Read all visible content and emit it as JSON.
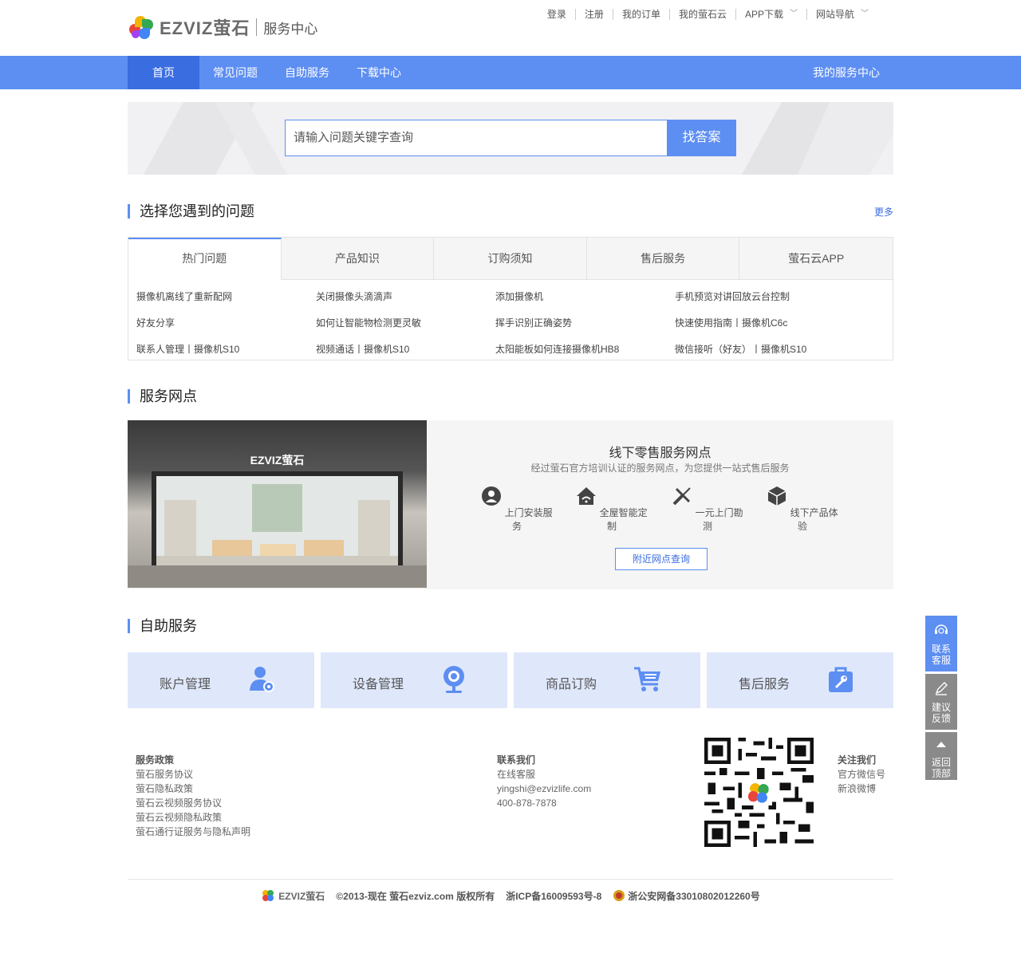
{
  "header": {
    "brand": "EZVIZ萤石",
    "service_center": "服务中心",
    "links": [
      "登录",
      "注册",
      "我的订单",
      "我的萤石云",
      "APP下载",
      "网站导航"
    ]
  },
  "nav": {
    "items": [
      "首页",
      "常见问题",
      "自助服务",
      "下载中心"
    ],
    "right": "我的服务中心"
  },
  "search": {
    "placeholder": "请输入问题关键字查询",
    "button": "找答案"
  },
  "problems": {
    "title": "选择您遇到的问题",
    "more": "更多",
    "tabs": [
      "热门问题",
      "产品知识",
      "订购须知",
      "售后服务",
      "萤石云APP"
    ],
    "links": [
      "摄像机离线了重新配网",
      "关闭摄像头滴滴声",
      "添加摄像机",
      "手机预览对讲回放云台控制",
      "好友分享",
      "如何让智能物检测更灵敏",
      "挥手识别正确姿势",
      "快速使用指南丨摄像机C6c",
      "联系人管理丨摄像机S10",
      "视频通话丨摄像机S10",
      "太阳能板如何连接摄像机HB8",
      "微信接听（好友）丨摄像机S10"
    ]
  },
  "outlets": {
    "title": "服务网点",
    "store_sign": "EZVIZ萤石",
    "heading": "线下零售服务网点",
    "subtitle": "经过萤石官方培训认证的服务网点，为您提供一站式售后服务",
    "features": [
      "上门安装服务",
      "全屋智能定制",
      "一元上门勘测",
      "线下产品体验"
    ],
    "button": "附近网点查询"
  },
  "self_service": {
    "title": "自助服务",
    "cards": [
      "账户管理",
      "设备管理",
      "商品订购",
      "售后服务"
    ]
  },
  "footer": {
    "policy": {
      "heading": "服务政策",
      "items": [
        "萤石服务协议",
        "萤石隐私政策",
        "萤石云视频服务协议",
        "萤石云视频隐私政策",
        "萤石通行证服务与隐私声明"
      ]
    },
    "contact": {
      "heading": "联系我们",
      "items": [
        "在线客服",
        "yingshi@ezvizlife.com",
        "400-878-7878"
      ]
    },
    "follow": {
      "heading": "关注我们",
      "items": [
        "官方微信号",
        "新浪微博"
      ]
    },
    "bottom": {
      "brand": "EZVIZ萤石",
      "copyright": "©2013-现在 萤石ezviz.com 版权所有",
      "icp": "浙ICP备16009593号-8",
      "police": "浙公安网备33010802012260号"
    }
  },
  "side": {
    "contact": [
      "联系",
      "客服"
    ],
    "feedback": [
      "建议",
      "反馈"
    ],
    "top": [
      "返回",
      "顶部"
    ]
  },
  "colors": {
    "primary": "#5d8ef2",
    "nav_active": "#3a6de0",
    "card_bg": "#dfe8fb",
    "side_blue": "#5d8ef2",
    "side_gray": "#8a8a8a"
  }
}
